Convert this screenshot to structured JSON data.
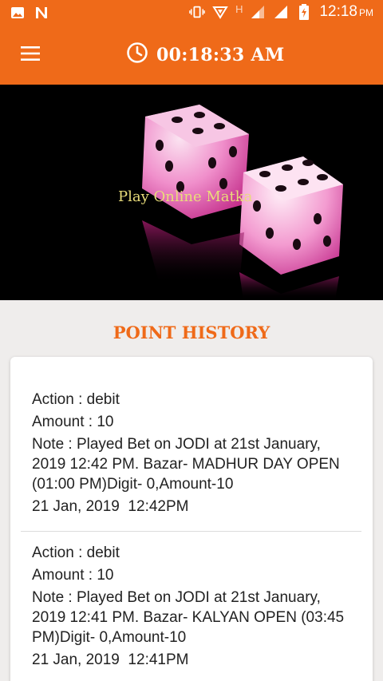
{
  "status_bar": {
    "time": "12:18",
    "ampm": "PM",
    "network": "H"
  },
  "app_bar": {
    "clock": "00:18:33 AM"
  },
  "banner": {
    "caption": "Play Online Matka"
  },
  "section": {
    "title": "POINT HISTORY"
  },
  "entries": [
    {
      "action": "Action : debit",
      "amount": "Amount : 10",
      "note": "Note : Played Bet on JODI at 21st January, 2019 12:42 PM. Bazar- MADHUR DAY OPEN (01:00 PM)Digit- 0,Amount-10",
      "date": "21 Jan, 2019  12:42PM"
    },
    {
      "action": "Action : debit",
      "amount": "Amount : 10",
      "note": "Note : Played Bet on JODI at 21st January, 2019 12:41 PM. Bazar- KALYAN  OPEN (03:45 PM)Digit- 0,Amount-10",
      "date": "21 Jan, 2019  12:41PM"
    }
  ],
  "colors": {
    "accent": "#ef6a19",
    "background": "#efedec"
  }
}
